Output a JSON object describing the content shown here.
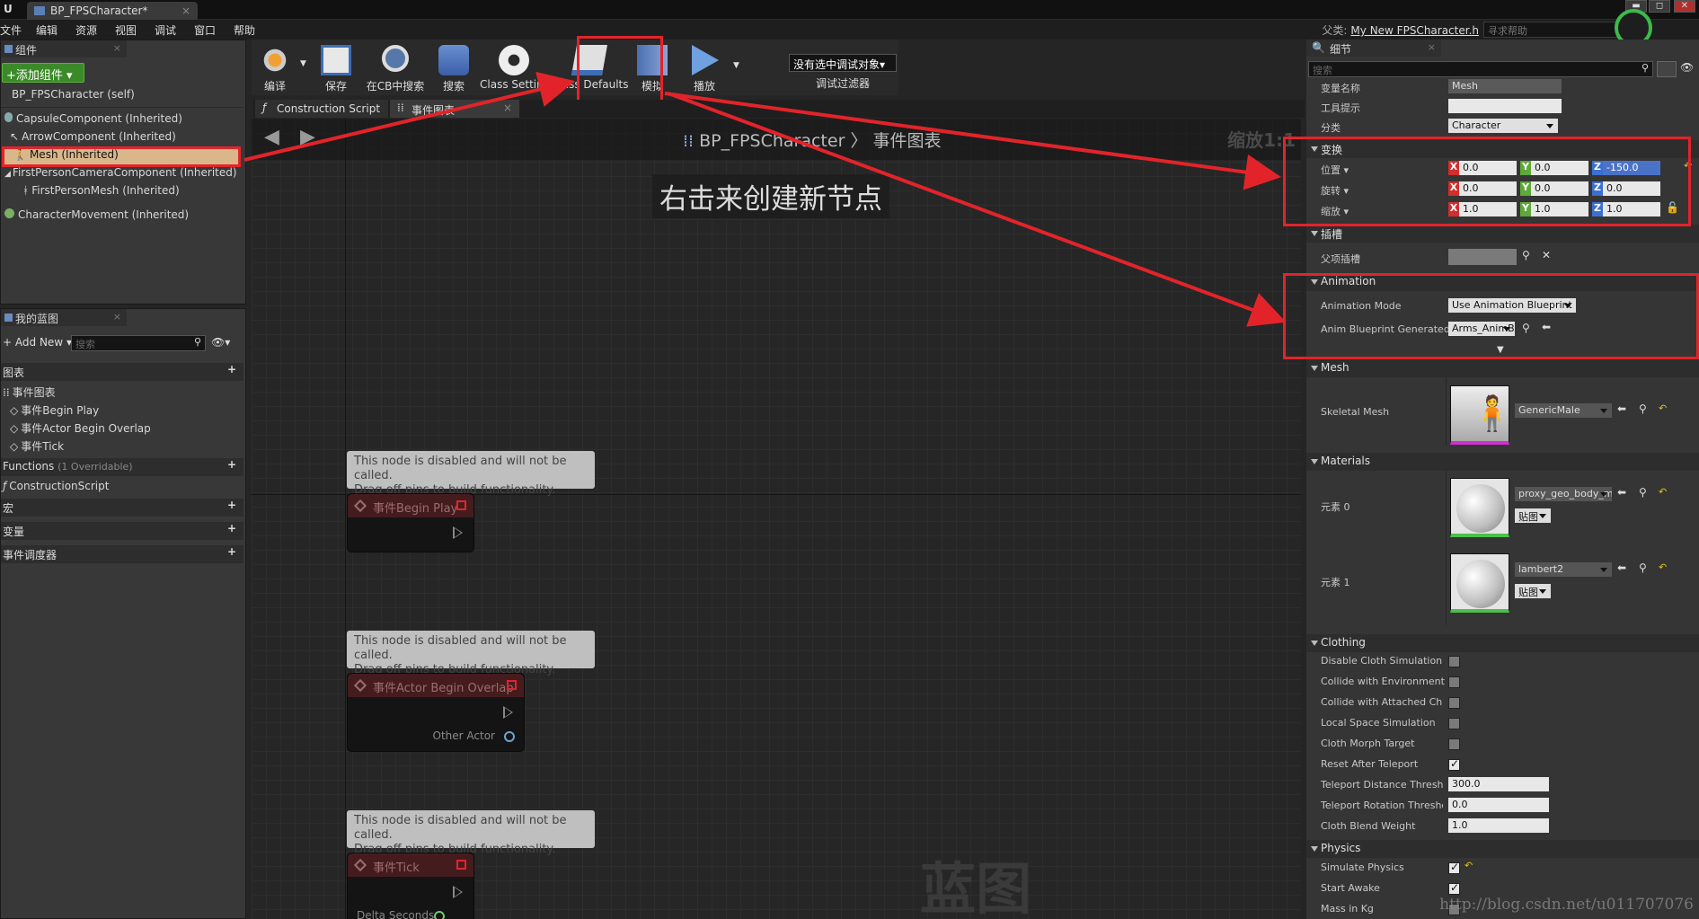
{
  "window": {
    "tab_title": "BP_FPSCharacter*",
    "tab_close": "×",
    "win_min": "▬",
    "win_max": "◻",
    "win_close": "✕"
  },
  "menubar": {
    "items": [
      "文件",
      "编辑",
      "资源",
      "视图",
      "调试",
      "窗口",
      "帮助"
    ],
    "parent_label": "父类:",
    "parent_class": "My New FPSCharacter.h",
    "help_search_placeholder": "寻求帮助"
  },
  "components": {
    "tab": "组件",
    "add_button": "+添加组件 ▾",
    "items": [
      {
        "label": "BP_FPSCharacter (self)"
      },
      {
        "label": "CapsuleComponent (Inherited)"
      },
      {
        "label": "ArrowComponent (Inherited)"
      },
      {
        "label": "Mesh (Inherited)"
      },
      {
        "label": "FirstPersonCameraComponent (Inherited)"
      },
      {
        "label": "FirstPersonMesh (Inherited)"
      },
      {
        "label": "CharacterMovement (Inherited)"
      }
    ]
  },
  "my_blueprint": {
    "tab": "我的蓝图",
    "add_new": "Add New",
    "search_placeholder": "搜索",
    "graphs_header": "图表",
    "event_graph": "事件图表",
    "events": [
      "事件Begin Play",
      "事件Actor Begin Overlap",
      "事件Tick"
    ],
    "functions_header": "Functions",
    "functions_count": "(1 Overridable)",
    "construction_script": "ConstructionScript",
    "macros_header": "宏",
    "variables_header": "变量",
    "dispatchers_header": "事件调度器"
  },
  "toolbar": {
    "compile": "编译",
    "save": "保存",
    "find_in_cb": "在CB中搜索",
    "search": "搜索",
    "class_settings": "Class Settings",
    "class_defaults": "Class Defaults",
    "simulate": "模拟",
    "play": "播放",
    "debug_object": "没有选中调试对象▾",
    "debug_filter": "调试过滤器"
  },
  "graph_tabs": {
    "construction": "Construction Script",
    "event_graph": "事件图表",
    "close": "×"
  },
  "graph": {
    "bp_name": "BP_FPSCharacter",
    "separator": "〉",
    "graph_name": "事件图表",
    "zoom": "缩放1:1",
    "hint": "右击来创建新节点",
    "watermark": "蓝图",
    "disabled_comment": "This node is disabled and will not be called.\nDrag off pins to build functionality.",
    "nodes": [
      {
        "title": "事件Begin Play"
      },
      {
        "title": "事件Actor Begin Overlap",
        "pin": "Other Actor"
      },
      {
        "title": "事件Tick",
        "pin": "Delta Seconds"
      }
    ]
  },
  "details": {
    "tab": "细节",
    "search_placeholder": "搜索",
    "variable_name_label": "变量名称",
    "variable_name_value": "Mesh",
    "tooltip_label": "工具提示",
    "category_label": "分类",
    "category_value": "Character",
    "transform_header": "变换",
    "location_label": "位置 ▾",
    "rotation_label": "旋转 ▾",
    "scale_label": "缩放 ▾",
    "location": {
      "x": "0.0",
      "y": "0.0",
      "z": "-150.0"
    },
    "rotation": {
      "x": "0.0",
      "y": "0.0",
      "z": "0.0"
    },
    "scale": {
      "x": "1.0",
      "y": "1.0",
      "z": "1.0"
    },
    "socket_header": "插槽",
    "parent_socket_label": "父项插槽",
    "animation_header": "Animation",
    "anim_mode_label": "Animation Mode",
    "anim_mode_value": "Use Animation Blueprint",
    "anim_bp_label": "Anim Blueprint Generated",
    "anim_bp_value": "Arms_AnimB",
    "mesh_header": "Mesh",
    "skeletal_mesh_label": "Skeletal Mesh",
    "skeletal_mesh_value": "GenericMale",
    "materials_header": "Materials",
    "element0_label": "元素 0",
    "element0_value": "proxy_geo_body_m",
    "element1_label": "元素 1",
    "element1_value": "lambert2",
    "texture_btn": "贴图",
    "clothing_header": "Clothing",
    "clothing_rows": [
      {
        "label": "Disable Cloth Simulation",
        "checked": false
      },
      {
        "label": "Collide with Environment",
        "checked": false
      },
      {
        "label": "Collide with Attached Children",
        "checked": false
      },
      {
        "label": "Local Space Simulation",
        "checked": false
      },
      {
        "label": "Cloth Morph Target",
        "checked": false
      },
      {
        "label": "Reset After Teleport",
        "checked": true
      }
    ],
    "teleport_distance_label": "Teleport Distance Threshold",
    "teleport_distance_value": "300.0",
    "teleport_rotation_label": "Teleport Rotation Threshold",
    "teleport_rotation_value": "0.0",
    "cloth_blend_label": "Cloth Blend Weight",
    "cloth_blend_value": "1.0",
    "physics_header": "Physics",
    "simulate_physics_label": "Simulate Physics",
    "start_awake_label": "Start Awake",
    "mass_label": "Mass in Kg"
  },
  "watermark_url": "http://blog.csdn.net/u011707076",
  "colors": {
    "annotation_red": "#e2242a",
    "add_green": "#3b8a28"
  }
}
